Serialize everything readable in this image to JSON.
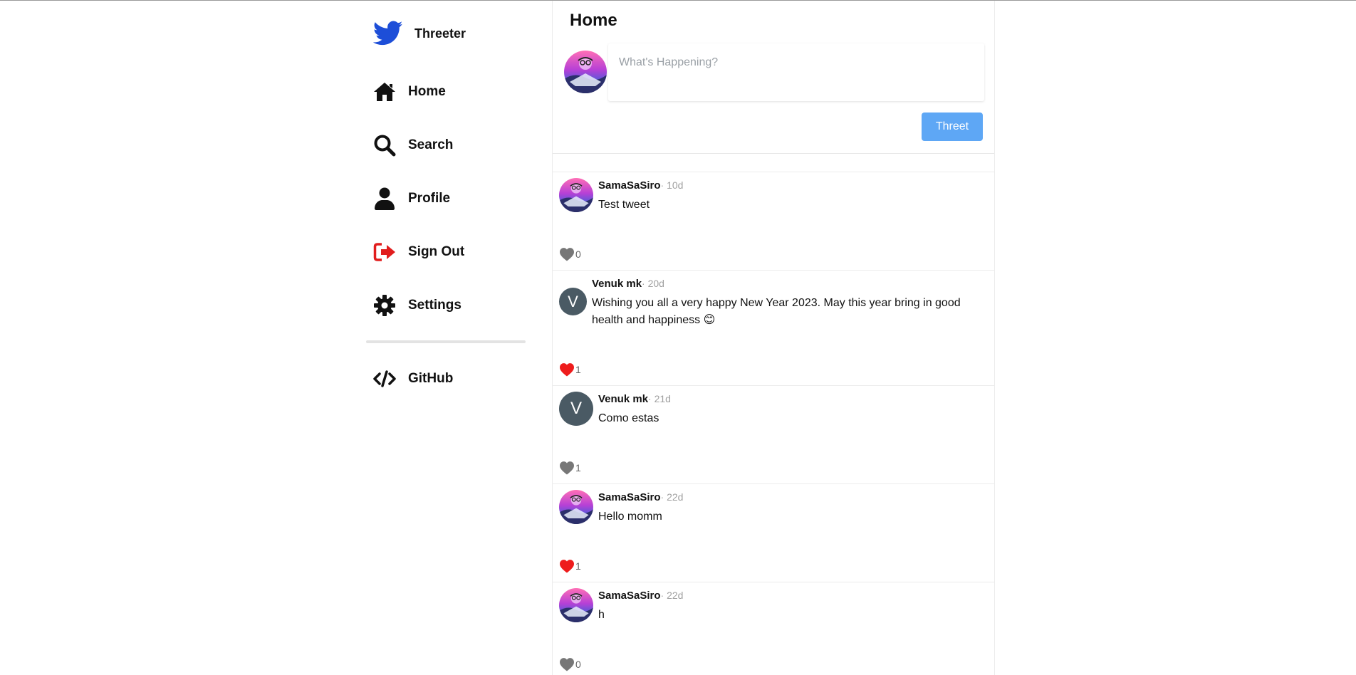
{
  "app": {
    "name": "Threeter"
  },
  "sidebar": {
    "items": [
      {
        "label": "Home",
        "icon": "home-icon"
      },
      {
        "label": "Search",
        "icon": "search-icon"
      },
      {
        "label": "Profile",
        "icon": "user-icon"
      },
      {
        "label": "Sign Out",
        "icon": "sign-out-icon"
      },
      {
        "label": "Settings",
        "icon": "gear-icon"
      },
      {
        "label": "GitHub",
        "icon": "code-icon"
      }
    ]
  },
  "main": {
    "title": "Home",
    "composer": {
      "placeholder": "What's Happening?",
      "button_label": "Threet"
    }
  },
  "feed": [
    {
      "author": "SamaSaSiro",
      "time": "· 10d",
      "text": "Test tweet",
      "likes": "0",
      "liked": false,
      "avatar": "image"
    },
    {
      "author": "Venuk mk",
      "time": "· 20d",
      "text": "Wishing you all a very happy New Year 2023. May this year bring in good health and happiness 😊",
      "likes": "1",
      "liked": true,
      "avatar": "V"
    },
    {
      "author": "Venuk mk",
      "time": "· 21d",
      "text": "Como estas",
      "likes": "1",
      "liked": false,
      "avatar": "V"
    },
    {
      "author": "SamaSaSiro",
      "time": "· 22d",
      "text": "Hello momm",
      "likes": "1",
      "liked": true,
      "avatar": "image"
    },
    {
      "author": "SamaSaSiro",
      "time": "· 22d",
      "text": "h",
      "likes": "0",
      "liked": false,
      "avatar": "image"
    }
  ],
  "colors": {
    "brand": "#1d4ed8",
    "button": "#5ea7f5",
    "like_active": "#ee1c1c",
    "like_inactive": "#777777",
    "sign_out": "#e11d1d",
    "letter_avatar": "#4a5a64"
  }
}
